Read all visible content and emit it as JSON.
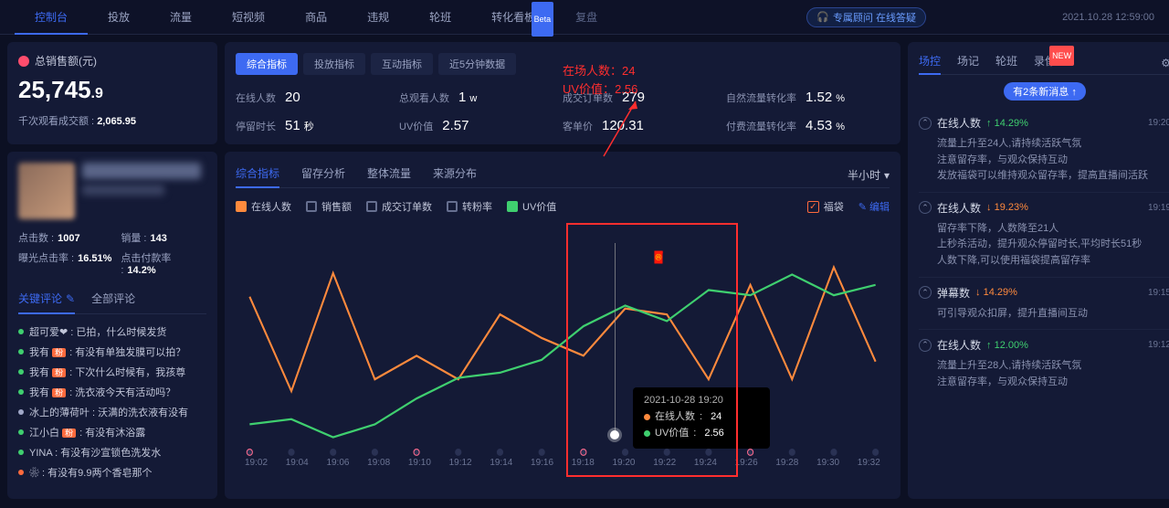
{
  "timestamp": "2021.10.28 12:59:00",
  "top_nav": {
    "tabs": [
      "控制台",
      "投放",
      "流量",
      "短视频",
      "商品",
      "违规",
      "轮班",
      "转化看板",
      "复盘"
    ],
    "active_index": 0,
    "beta_index": 7,
    "support_text": "专属顾问 在线答疑"
  },
  "sales": {
    "title": "总销售额(元)",
    "amount_int": "25,745",
    "amount_dec": ".9",
    "sub_label": "千次观看成交额 :",
    "sub_value": "2,065.95"
  },
  "profile": {
    "stats": [
      {
        "label": "点击数 :",
        "value": "1007"
      },
      {
        "label": "销量 :",
        "value": "143"
      },
      {
        "label": "曝光点击率 :",
        "value": "16.51%"
      },
      {
        "label": "点击付款率 :",
        "value": "14.2%"
      }
    ]
  },
  "comments": {
    "tabs": [
      "关键评论",
      "全部评论"
    ],
    "active_index": 0,
    "items": [
      {
        "dot": "#3fcf6f",
        "user": "超可爱❤",
        "tag": "",
        "tagColor": "",
        "text": ": 已拍，什么时候发货"
      },
      {
        "dot": "#3fcf6f",
        "user": "我有",
        "tag": "粉",
        "tagColor": "#ff6a3d",
        "text": ": 有没有单独发膜可以拍？"
      },
      {
        "dot": "#3fcf6f",
        "user": "我有",
        "tag": "粉",
        "tagColor": "#ff6a3d",
        "text": ": 下次什么时候有，我孩尊"
      },
      {
        "dot": "#3fcf6f",
        "user": "我有",
        "tag": "粉",
        "tagColor": "#ff6a3d",
        "text": ": 洗衣液今天有活动吗？"
      },
      {
        "dot": "#a0a8c8",
        "user": "冰上的薄荷叶",
        "tag": "",
        "tagColor": "",
        "text": ": 沃满的洗衣液有没有"
      },
      {
        "dot": "#3fcf6f",
        "user": "江小白",
        "tag": "粉",
        "tagColor": "#ff6a3d",
        "text": ": 有没有沐浴露"
      },
      {
        "dot": "#3fcf6f",
        "user": "YINA",
        "tag": "",
        "tagColor": "",
        "text": ": 有没有沙宣锁色洗发水"
      },
      {
        "dot": "#ff6a3d",
        "user": "❀",
        "tag": "",
        "tagColor": "",
        "text": ": 有没有9.9两个香皂那个"
      }
    ]
  },
  "metric_tabs": {
    "tabs": [
      "综合指标",
      "投放指标",
      "互动指标",
      "近5分钟数据"
    ],
    "active_index": 0
  },
  "metrics": [
    {
      "label": "在线人数",
      "value": "20",
      "unit": ""
    },
    {
      "label": "总观看人数",
      "value": "1",
      "unit": "w"
    },
    {
      "label": "成交订单数",
      "value": "279",
      "unit": ""
    },
    {
      "label": "自然流量转化率",
      "value": "1.52",
      "unit": "%"
    },
    {
      "label": "停留时长",
      "value": "51",
      "unit": "秒"
    },
    {
      "label": "UV价值",
      "value": "2.57",
      "unit": ""
    },
    {
      "label": "客单价",
      "value": "120.31",
      "unit": ""
    },
    {
      "label": "付费流量转化率",
      "value": "4.53",
      "unit": "%"
    }
  ],
  "chart": {
    "tabs": [
      "综合指标",
      "留存分析",
      "整体流量",
      "来源分布"
    ],
    "active_index": 0,
    "period": "半小时",
    "legend": [
      {
        "name": "在线人数",
        "color": "#ff8a3d",
        "active": true
      },
      {
        "name": "销售额",
        "color": "#666f90",
        "active": false
      },
      {
        "name": "成交订单数",
        "color": "#666f90",
        "active": false
      },
      {
        "name": "转粉率",
        "color": "#666f90",
        "active": false
      },
      {
        "name": "UV价值",
        "color": "#3fcf6f",
        "active": true
      }
    ],
    "checkbox_label": "福袋",
    "edit_label": "编辑",
    "x_ticks": [
      "19:02",
      "19:04",
      "19:06",
      "19:08",
      "19:10",
      "19:12",
      "19:14",
      "19:16",
      "19:18",
      "19:20",
      "19:22",
      "19:24",
      "19:26",
      "19:28",
      "19:30",
      "19:32"
    ],
    "tooltip": {
      "title": "2021-10-28 19:20",
      "rows": [
        {
          "label": "在线人数",
          "value": "24",
          "color": "#ff8a3d"
        },
        {
          "label": "UV价值",
          "value": "2.56",
          "color": "#3fcf6f"
        }
      ]
    }
  },
  "chart_data": {
    "type": "line",
    "x": [
      "19:02",
      "19:04",
      "19:06",
      "19:08",
      "19:10",
      "19:12",
      "19:14",
      "19:16",
      "19:18",
      "19:20",
      "19:22",
      "19:24",
      "19:26",
      "19:28",
      "19:30",
      "19:32"
    ],
    "series": [
      {
        "name": "在线人数",
        "color": "#ff8a3d",
        "values": [
          26,
          10,
          30,
          12,
          16,
          12,
          23,
          19,
          16,
          24,
          23,
          12,
          28,
          12,
          31,
          15
        ]
      },
      {
        "name": "UV价值",
        "color": "#3fcf6f",
        "values": [
          2.1,
          2.12,
          2.05,
          2.1,
          2.2,
          2.28,
          2.3,
          2.35,
          2.48,
          2.56,
          2.5,
          2.62,
          2.6,
          2.68,
          2.6,
          2.64
        ]
      }
    ],
    "ylim": [
      0,
      35
    ],
    "y2lim": [
      2.0,
      2.8
    ]
  },
  "annotation": {
    "line1_label": "在场人数：",
    "line1_value": "24",
    "line2_label": "UV价值：",
    "line2_value": "2.56"
  },
  "right": {
    "tabs": [
      "场控",
      "场记",
      "轮班",
      "录像"
    ],
    "active_index": 0,
    "new_index": 3,
    "notif": "有2条新消息 ↑",
    "feed": [
      {
        "metric": "在线人数",
        "dir": "up",
        "change": "14.29%",
        "time": "19:20",
        "lines": [
          "流量上升至24人,请持续活跃气氛",
          "注意留存率，与观众保持互动",
          "发放福袋可以维持观众留存率，提高直播间活跃"
        ]
      },
      {
        "metric": "在线人数",
        "dir": "down",
        "change": "19.23%",
        "time": "19:19",
        "lines": [
          "留存率下降，人数降至21人",
          "上秒杀活动，提升观众停留时长,平均时长51秒",
          "人数下降,可以使用福袋提高留存率"
        ]
      },
      {
        "metric": "弹幕数",
        "dir": "down",
        "change": "14.29%",
        "time": "19:15",
        "lines": [
          "可引导观众扣屏，提升直播间互动"
        ]
      },
      {
        "metric": "在线人数",
        "dir": "up",
        "change": "12.00%",
        "time": "19:12",
        "lines": [
          "流量上升至28人,请持续活跃气氛",
          "注意留存率，与观众保持互动"
        ]
      }
    ]
  }
}
